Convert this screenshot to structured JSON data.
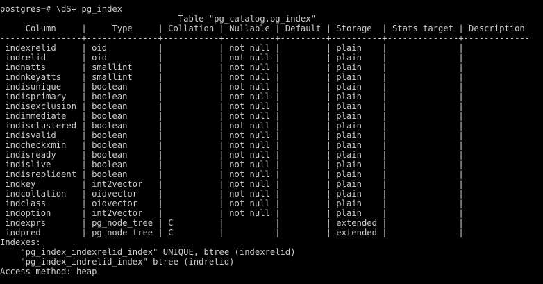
{
  "terminal": {
    "prompt_line": "postgres=# \\dS+ pg_index",
    "table_title": "                                   Table \"pg_catalog.pg_index\"",
    "header_row": "     Column     |     Type     | Collation | Nullable | Default | Storage  | Stats target | Description",
    "separator_row": "----------------+--------------+-----------+----------+---------+----------+--------------+-------------",
    "rows": [
      " indexrelid     | oid          |           | not null |         | plain    |              |",
      " indrelid       | oid          |           | not null |         | plain    |              |",
      " indnatts       | smallint     |           | not null |         | plain    |              |",
      " indnkeyatts    | smallint     |           | not null |         | plain    |              |",
      " indisunique    | boolean      |           | not null |         | plain    |              |",
      " indisprimary   | boolean      |           | not null |         | plain    |              |",
      " indisexclusion | boolean      |           | not null |         | plain    |              |",
      " indimmediate   | boolean      |           | not null |         | plain    |              |",
      " indisclustered | boolean      |           | not null |         | plain    |              |",
      " indisvalid     | boolean      |           | not null |         | plain    |              |",
      " indcheckxmin   | boolean      |           | not null |         | plain    |              |",
      " indisready     | boolean      |           | not null |         | plain    |              |",
      " indislive      | boolean      |           | not null |         | plain    |              |",
      " indisreplident | boolean      |           | not null |         | plain    |              |",
      " indkey         | int2vector   |           | not null |         | plain    |              |",
      " indcollation   | oidvector    |           | not null |         | plain    |              |",
      " indclass       | oidvector    |           | not null |         | plain    |              |",
      " indoption      | int2vector   |           | not null |         | plain    |              |",
      " indexprs       | pg_node_tree | C         |          |         | extended |              |",
      " indpred        | pg_node_tree | C         |          |         | extended |              |"
    ],
    "indexes_heading": "Indexes:",
    "index_lines": [
      "    \"pg_index_indexrelid_index\" UNIQUE, btree (indexrelid)",
      "    \"pg_index_indrelid_index\" btree (indrelid)"
    ],
    "access_method": "Access method: heap",
    "colors": {
      "background": "#000000",
      "text": "#cccccc"
    }
  }
}
